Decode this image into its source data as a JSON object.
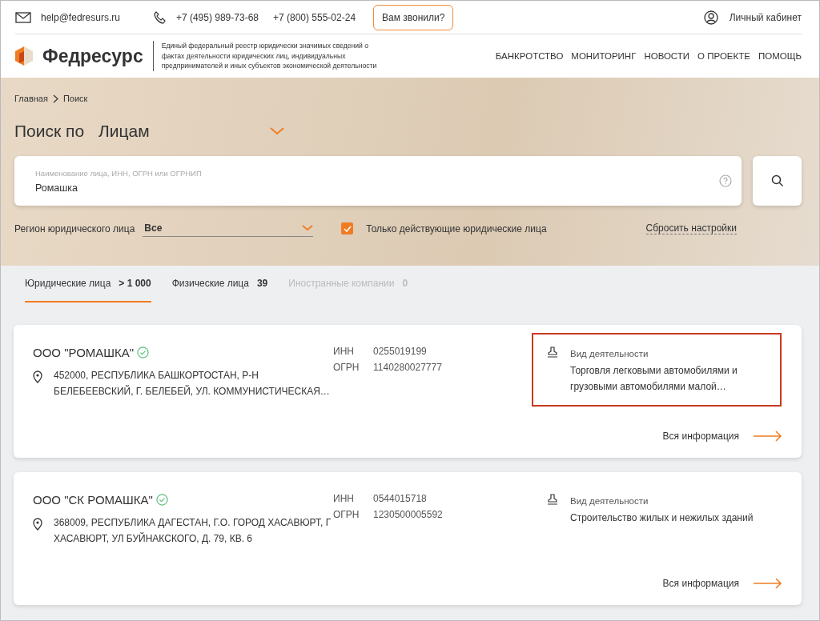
{
  "top_bar": {
    "email": "help@fedresurs.ru",
    "phones": [
      "+7 (495) 989-73-68",
      "+7 (800) 555-02-24"
    ],
    "call_button": "Вам звонили?",
    "account": "Личный кабинет"
  },
  "header": {
    "logo": "Федресурс",
    "tagline": "Единый федеральный реестр юридически значимых сведений о фактах деятельности юридических лиц, индивидуальных предпринимателей и иных субъектов экономической деятельности",
    "nav": [
      "БАНКРОТСТВО",
      "МОНИТОРИНГ",
      "НОВОСТИ",
      "О ПРОЕКТЕ",
      "ПОМОЩЬ"
    ]
  },
  "breadcrumbs": [
    "Главная",
    "Поиск"
  ],
  "search": {
    "title": "Поиск по",
    "type": "Лицам",
    "label": "Наименование лица, ИНН, ОГРН или ОГРНИП",
    "value": "Ромашка",
    "region_label": "Регион юридического лица",
    "region_value": "Все",
    "active_only": {
      "label": "Только действующие юридические лица",
      "checked": true
    },
    "reset": "Сбросить настройки"
  },
  "tabs": [
    {
      "label": "Юридические лица",
      "count": "> 1 000",
      "selected": true,
      "disabled": false
    },
    {
      "label": "Физические лица",
      "count": "39",
      "selected": false,
      "disabled": false
    },
    {
      "label": "Иностранные компании",
      "count": "0",
      "selected": false,
      "disabled": true
    }
  ],
  "results": [
    {
      "name": "ООО \"РОМАШКА\"",
      "verified": true,
      "address": "452000, РЕСПУБЛИКА БАШКОРТОСТАН, Р-Н БЕЛЕБЕЕВСКИЙ, Г. БЕЛЕБЕЙ, УЛ. КОММУНИСТИЧЕСКАЯ…",
      "inn_label": "ИНН",
      "inn": "0255019199",
      "ogrn_label": "ОГРН",
      "ogrn": "1140280027777",
      "activity_label": "Вид деятельности",
      "activity": "Торговля легковыми автомобилями и грузовыми автомобилями малой…",
      "highlighted": true,
      "link": "Вся информация"
    },
    {
      "name": "ООО \"СК РОМАШКА\"",
      "verified": true,
      "address": "368009, РЕСПУБЛИКА ДАГЕСТАН, Г.О. ГОРОД ХАСАВЮРТ, Г ХАСАВЮРТ, УЛ БУЙНАКСКОГО, Д. 79, КВ. 6",
      "inn_label": "ИНН",
      "inn": "0544015718",
      "ogrn_label": "ОГРН",
      "ogrn": "1230500005592",
      "activity_label": "Вид деятельности",
      "activity": "Строительство жилых и нежилых зданий",
      "highlighted": false,
      "link": "Вся информация"
    }
  ]
}
